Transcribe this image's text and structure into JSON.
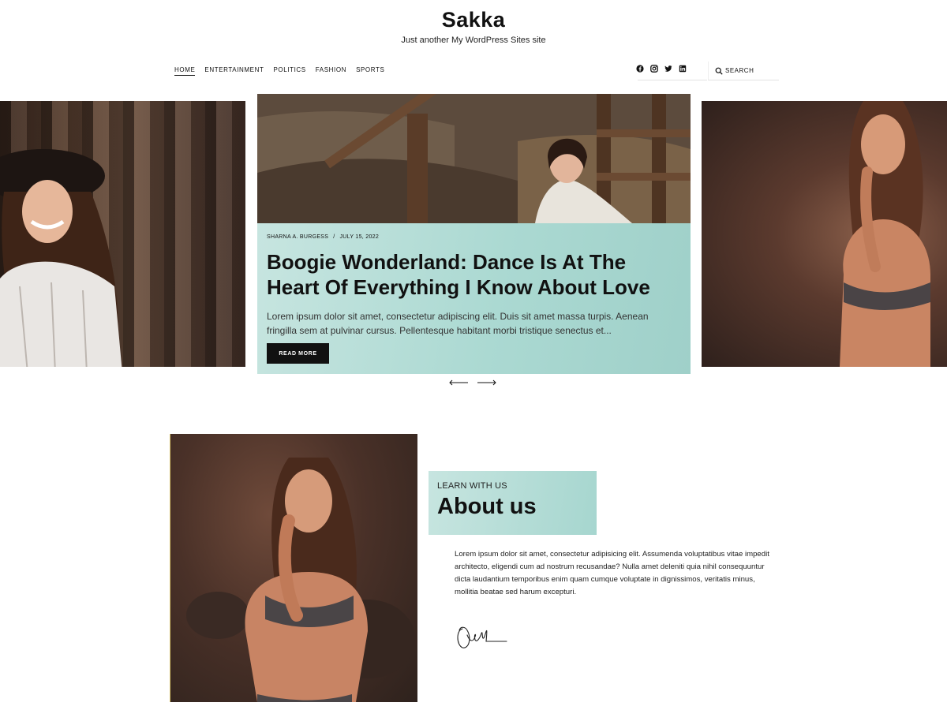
{
  "header": {
    "site_title": "Sakka",
    "tagline": "Just another My WordPress Sites site"
  },
  "nav": {
    "items": [
      {
        "label": "HOME",
        "active": true
      },
      {
        "label": "ENTERTAINMENT"
      },
      {
        "label": "POLITICS"
      },
      {
        "label": "FASHION"
      },
      {
        "label": "SPORTS"
      }
    ]
  },
  "social": [
    "facebook-icon",
    "instagram-icon",
    "twitter-icon",
    "linkedin-icon"
  ],
  "search": {
    "label": "SEARCH"
  },
  "slider": {
    "featured": {
      "author": "SHARNA A. BURGESS",
      "separator": "/",
      "date": "JULY 15, 2022",
      "title": "Boogie Wonderland: Dance Is At The Heart Of Everything I Know About Love",
      "excerpt": "Lorem ipsum dolor sit amet, consectetur adipiscing elit. Duis sit amet massa turpis. Aenean fringilla sem at pulvinar cursus. Pellentesque habitant morbi tristique senectus et...",
      "button": "READ MORE"
    }
  },
  "about": {
    "kicker": "LEARN WITH US",
    "title": "About us",
    "text": "Lorem ipsum dolor sit amet, consectetur adipisicing elit. Assumenda voluptatibus vitae impedit architecto, eligendi cum ad nostrum recusandae? Nulla amet deleniti quia nihil consequuntur dicta laudantium temporibus enim quam cumque voluptate in dignissimos, veritatis minus, mollitia beatae sed harum excepturi."
  },
  "colors": {
    "accent_mint": "#abd9d2",
    "text_dark": "#111111",
    "button_bg": "#111111"
  }
}
